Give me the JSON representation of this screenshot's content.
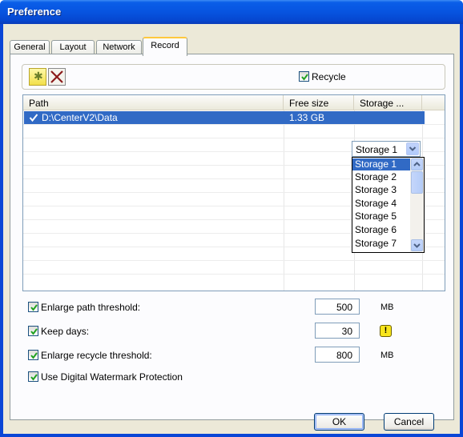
{
  "window": {
    "title": "Preference"
  },
  "tabs": [
    {
      "label": "General"
    },
    {
      "label": "Layout"
    },
    {
      "label": "Network"
    },
    {
      "label": "Record"
    }
  ],
  "active_tab": "Record",
  "toolbar": {
    "add_icon": "add-star-icon",
    "delete_icon": "delete-x-icon",
    "recycle_label": "Recycle",
    "recycle_checked": true
  },
  "list": {
    "columns": [
      "Path",
      "Free size",
      "Storage ..."
    ],
    "rows": [
      {
        "checked": true,
        "path": "D:\\CenterV2\\Data",
        "free_size": "1.33 GB",
        "storage": "Storage 1"
      }
    ]
  },
  "storage_dropdown": {
    "selected": "Storage 1",
    "options": [
      "Storage 1",
      "Storage 2",
      "Storage 3",
      "Storage 4",
      "Storage 5",
      "Storage 6",
      "Storage 7"
    ]
  },
  "settings": {
    "enlarge_path": {
      "label": "Enlarge path threshold:",
      "value": "500",
      "unit": "MB",
      "checked": true
    },
    "keep_days": {
      "label": "Keep days:",
      "value": "30",
      "checked": true,
      "icon": "warning-icon",
      "icon_glyph": "!"
    },
    "enlarge_recycle": {
      "label": "Enlarge recycle threshold:",
      "value": "800",
      "unit": "MB",
      "checked": true
    },
    "watermark": {
      "label": "Use Digital Watermark Protection",
      "checked": true
    }
  },
  "buttons": {
    "ok": "OK",
    "cancel": "Cancel"
  },
  "colors": {
    "title_bar": "#0754e0",
    "selection": "#316ac5",
    "dialog_bg": "#ece9d8"
  }
}
